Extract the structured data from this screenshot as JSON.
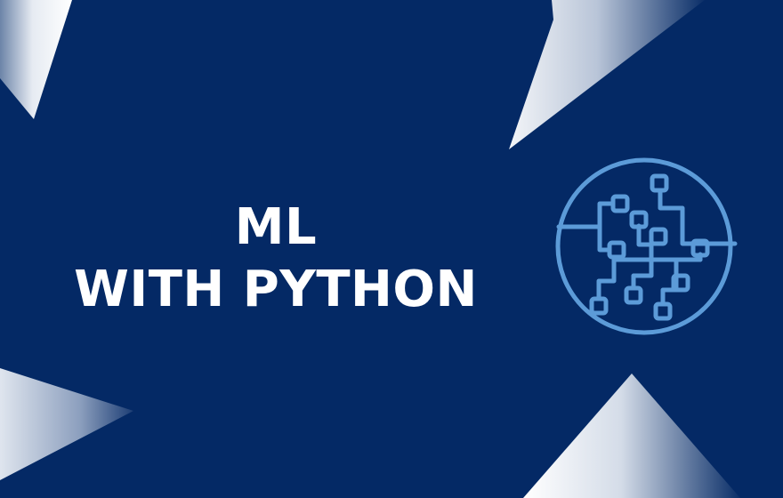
{
  "title": {
    "line1": "ML",
    "line2": "WITH PYTHON"
  },
  "colors": {
    "background": "#042965",
    "text": "#ffffff",
    "icon": "#5C9BD8",
    "shape_light": "#EEF1F6",
    "shape_dark": "#042965"
  },
  "icon": {
    "name": "circuit-brain-icon"
  }
}
